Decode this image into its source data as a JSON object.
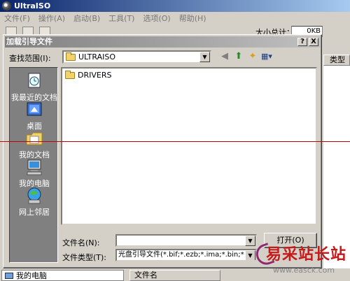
{
  "app": {
    "title": "UltraISO",
    "menu": [
      "文件(F)",
      "操作(A)",
      "启动(B)",
      "工具(T)",
      "选项(O)",
      "帮助(H)"
    ],
    "size_label": "大小总计：",
    "size_value": "0KB",
    "column_type": "类型",
    "status_left": "我的电脑",
    "status_mid": "文件名"
  },
  "dialog": {
    "title": "加载引导文件",
    "help_button": "?",
    "close_button": "X",
    "lookin_label": "查找范围(I):",
    "lookin_value": "ULTRAISO",
    "places": [
      "我最近的文档",
      "桌面",
      "我的文档",
      "我的电脑",
      "网上邻居"
    ],
    "files": [
      {
        "name": "DRIVERS",
        "icon": "folder-icon"
      }
    ],
    "filename_label": "文件名(N):",
    "filename_value": "",
    "filetype_label": "文件类型(T):",
    "filetype_value": "光盘引导文件(*.bif;*.ezb;*.ima;*.bin;*",
    "open_button": "打开(O)"
  },
  "watermark": {
    "title": "易采站长站",
    "url": "www.easck.com"
  },
  "colors": {
    "title_active": "#0a246a",
    "title_inactive": "#808080",
    "face": "#d4d0c8",
    "watermark_red": "#c41a1a",
    "guide_line": "#c00000"
  }
}
